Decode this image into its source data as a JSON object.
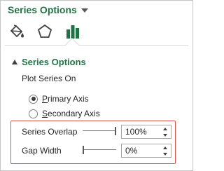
{
  "header": {
    "title": "Series Options",
    "menu_icon": "chevron-down-icon"
  },
  "tabs": [
    {
      "icon": "paint-bucket-icon",
      "label": "Fill & Line",
      "selected": false
    },
    {
      "icon": "pentagon-icon",
      "label": "Effects",
      "selected": false
    },
    {
      "icon": "bar-chart-icon",
      "label": "Series Options",
      "selected": true
    }
  ],
  "section": {
    "title": "Series Options",
    "expanded": true,
    "plot_series_on_label": "Plot Series On",
    "radios": [
      {
        "label": "Primary Axis",
        "underline_char": "P",
        "checked": true
      },
      {
        "label": "Secondary Axis",
        "underline_char": "S",
        "checked": false
      }
    ],
    "series_overlap": {
      "label": "Series Overlap",
      "value": "100%",
      "slider_fraction": 1.0
    },
    "gap_width": {
      "label": "Gap Width",
      "value": "0%",
      "slider_fraction": 0.0
    }
  },
  "colors": {
    "accent": "#217346",
    "highlight": "#d9534f"
  }
}
